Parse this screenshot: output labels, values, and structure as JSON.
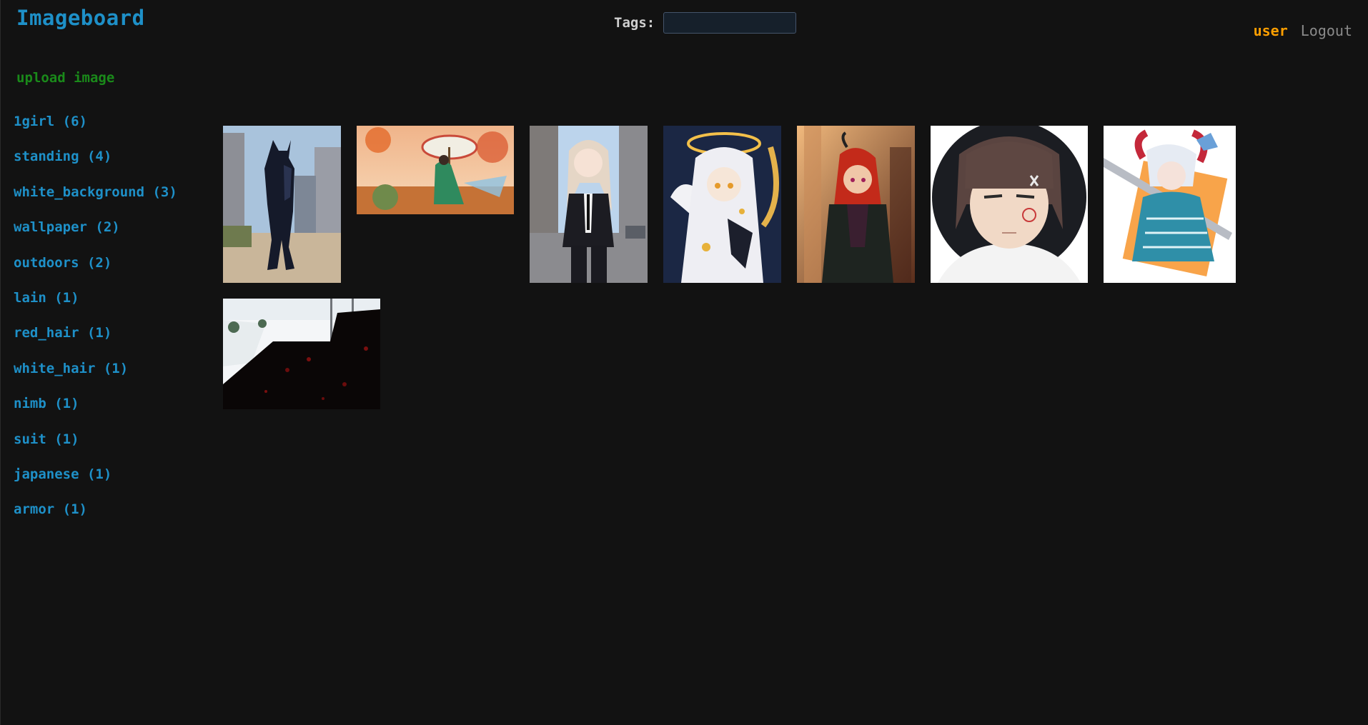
{
  "header": {
    "logo": "Imageboard",
    "tags_label": "Tags:",
    "tags_value": "",
    "tags_placeholder": ""
  },
  "user_nav": {
    "user": "user",
    "logout": "Logout"
  },
  "sidebar": {
    "upload": "upload image",
    "tags": [
      {
        "label": "1girl (6)"
      },
      {
        "label": "standing (4)"
      },
      {
        "label": "white_background (3)"
      },
      {
        "label": "wallpaper (2)"
      },
      {
        "label": "outdoors (2)"
      },
      {
        "label": "lain (1)"
      },
      {
        "label": "red_hair (1)"
      },
      {
        "label": "white_hair (1)"
      },
      {
        "label": "nimb (1)"
      },
      {
        "label": "suit (1)"
      },
      {
        "label": "japanese (1)"
      },
      {
        "label": "armor (1)"
      }
    ]
  },
  "gallery": {
    "images": [
      {
        "name": "armored-knight-city-thumbnail"
      },
      {
        "name": "japanese-umbrella-autumn-thumbnail"
      },
      {
        "name": "girl-in-suit-street-thumbnail"
      },
      {
        "name": "angel-white-hair-halo-thumbnail"
      },
      {
        "name": "red-hair-horns-girl-thumbnail"
      },
      {
        "name": "lain-portrait-thumbnail"
      },
      {
        "name": "horned-girl-sword-thumbnail"
      },
      {
        "name": "dark-street-shadow-thumbnail"
      }
    ]
  },
  "colors": {
    "background": "#121212",
    "link_blue": "#1e90c8",
    "upload_green": "#1a8a1a",
    "user_orange": "#ff9f00",
    "logout_gray": "#8a8a8a"
  }
}
